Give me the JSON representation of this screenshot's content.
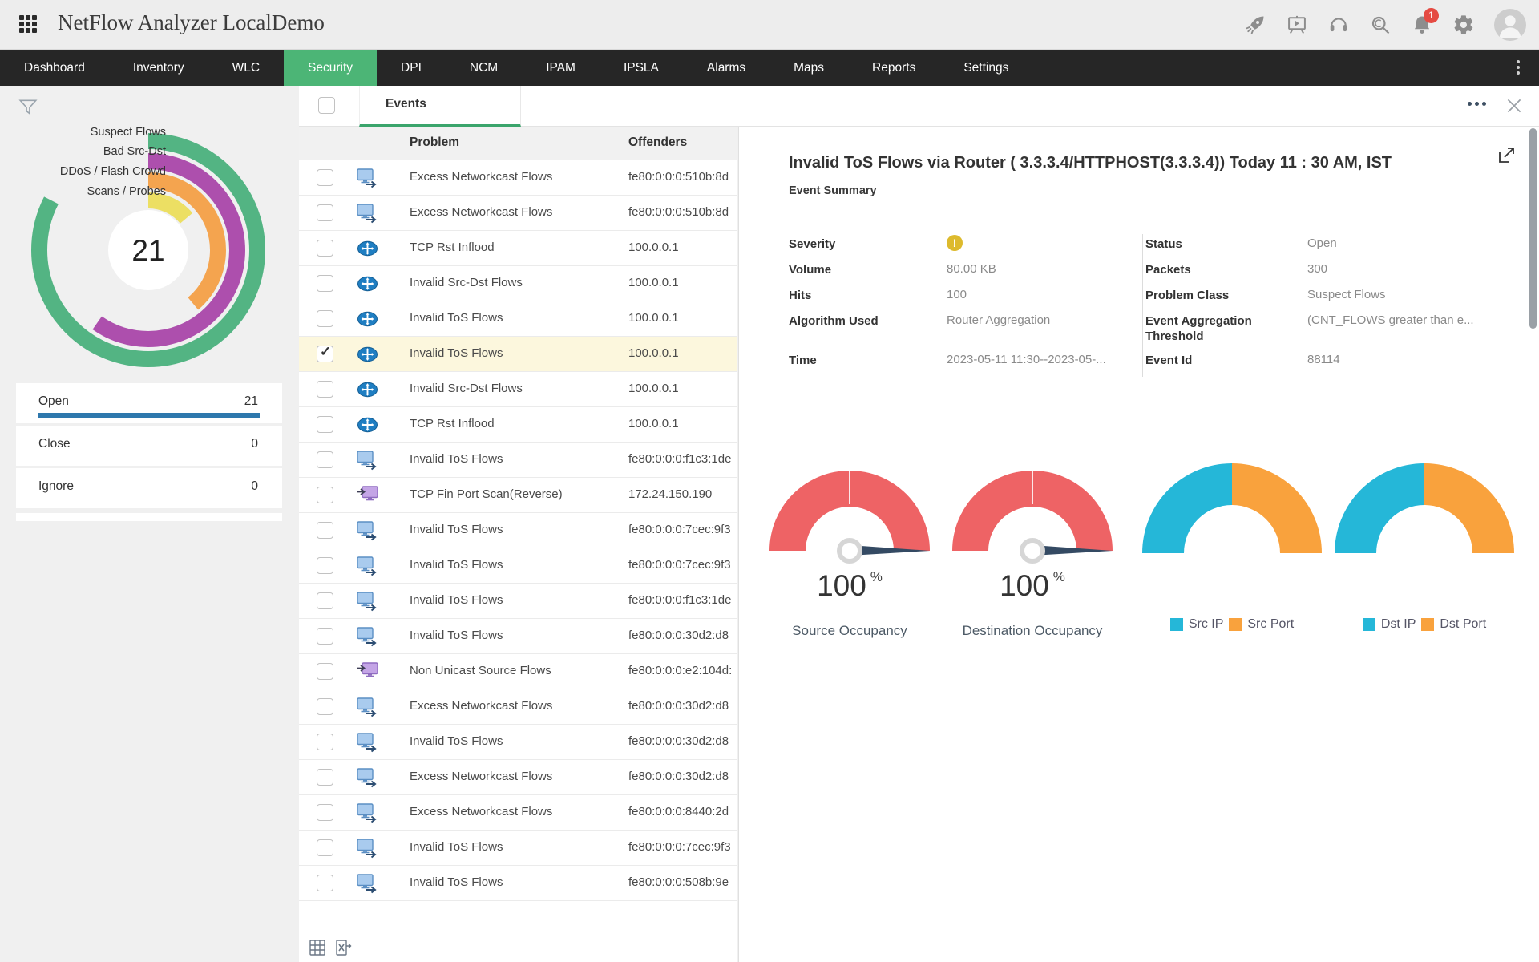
{
  "topbar": {
    "title": "NetFlow Analyzer LocalDemo",
    "notification_count": "1"
  },
  "nav": {
    "items": [
      {
        "label": "Dashboard",
        "state": ""
      },
      {
        "label": "Inventory",
        "state": ""
      },
      {
        "label": "WLC",
        "state": ""
      },
      {
        "label": "Security",
        "state": "active"
      },
      {
        "label": "DPI",
        "state": ""
      },
      {
        "label": "NCM",
        "state": ""
      },
      {
        "label": "IPAM",
        "state": ""
      },
      {
        "label": "IPSLA",
        "state": ""
      },
      {
        "label": "Alarms",
        "state": ""
      },
      {
        "label": "Maps",
        "state": ""
      },
      {
        "label": "Reports",
        "state": ""
      },
      {
        "label": "Settings",
        "state": ""
      }
    ],
    "active_color": "#4cb576"
  },
  "sidebar": {
    "chart": {
      "type": "radial-bar",
      "total": "21",
      "series": [
        {
          "label": "Suspect Flows",
          "color": "#53b483",
          "sweep_deg": 297
        },
        {
          "label": "Bad Src-Dst",
          "color": "#ad4fad",
          "sweep_deg": 215
        },
        {
          "label": "DDoS / Flash Crowd",
          "color": "#f4a44f",
          "sweep_deg": 140
        },
        {
          "label": "Scans / Probes",
          "color": "#ecdf63",
          "sweep_deg": 50
        }
      ]
    },
    "status": [
      {
        "label": "Open",
        "value": "21",
        "bar": "1",
        "bar_color": "#2e78ad"
      },
      {
        "label": "Close",
        "value": "0",
        "bar": "0",
        "bar_color": ""
      },
      {
        "label": "Ignore",
        "value": "0",
        "bar": "0",
        "bar_color": ""
      }
    ]
  },
  "events": {
    "tab_label": "Events",
    "columns": {
      "problem": "Problem",
      "offenders": "Offenders"
    },
    "rows": [
      {
        "icon": "host",
        "problem": "Excess Networkcast Flows",
        "offender": "fe80:0:0:0:510b:8d",
        "state": "",
        "checked": ""
      },
      {
        "icon": "host",
        "problem": "Excess Networkcast Flows",
        "offender": "fe80:0:0:0:510b:8d",
        "state": "",
        "checked": ""
      },
      {
        "icon": "router",
        "problem": "TCP Rst Inflood",
        "offender": "100.0.0.1",
        "state": "",
        "checked": ""
      },
      {
        "icon": "router",
        "problem": "Invalid Src-Dst Flows",
        "offender": "100.0.0.1",
        "state": "",
        "checked": ""
      },
      {
        "icon": "router",
        "problem": "Invalid ToS Flows",
        "offender": "100.0.0.1",
        "state": "",
        "checked": ""
      },
      {
        "icon": "router",
        "problem": "Invalid ToS Flows",
        "offender": "100.0.0.1",
        "state": "selected",
        "checked": "checked"
      },
      {
        "icon": "router",
        "problem": "Invalid Src-Dst Flows",
        "offender": "100.0.0.1",
        "state": "",
        "checked": ""
      },
      {
        "icon": "router",
        "problem": "TCP Rst Inflood",
        "offender": "100.0.0.1",
        "state": "",
        "checked": ""
      },
      {
        "icon": "host",
        "problem": "Invalid ToS Flows",
        "offender": "fe80:0:0:0:f1c3:1de",
        "state": "",
        "checked": ""
      },
      {
        "icon": "reverse",
        "problem": "TCP Fin Port Scan(Reverse)",
        "offender": "172.24.150.190",
        "state": "",
        "checked": ""
      },
      {
        "icon": "host",
        "problem": "Invalid ToS Flows",
        "offender": "fe80:0:0:0:7cec:9f3",
        "state": "",
        "checked": ""
      },
      {
        "icon": "host",
        "problem": "Invalid ToS Flows",
        "offender": "fe80:0:0:0:7cec:9f3",
        "state": "",
        "checked": ""
      },
      {
        "icon": "host",
        "problem": "Invalid ToS Flows",
        "offender": "fe80:0:0:0:f1c3:1de",
        "state": "",
        "checked": ""
      },
      {
        "icon": "host",
        "problem": "Invalid ToS Flows",
        "offender": "fe80:0:0:0:30d2:d8",
        "state": "",
        "checked": ""
      },
      {
        "icon": "reverse",
        "problem": "Non Unicast Source Flows",
        "offender": "fe80:0:0:0:e2:104d:",
        "state": "",
        "checked": ""
      },
      {
        "icon": "host",
        "problem": "Excess Networkcast Flows",
        "offender": "fe80:0:0:0:30d2:d8",
        "state": "",
        "checked": ""
      },
      {
        "icon": "host",
        "problem": "Invalid ToS Flows",
        "offender": "fe80:0:0:0:30d2:d8",
        "state": "",
        "checked": ""
      },
      {
        "icon": "host",
        "problem": "Excess Networkcast Flows",
        "offender": "fe80:0:0:0:30d2:d8",
        "state": "",
        "checked": ""
      },
      {
        "icon": "host",
        "problem": "Excess Networkcast Flows",
        "offender": "fe80:0:0:0:8440:2d",
        "state": "",
        "checked": ""
      },
      {
        "icon": "host",
        "problem": "Invalid ToS Flows",
        "offender": "fe80:0:0:0:7cec:9f3",
        "state": "",
        "checked": ""
      },
      {
        "icon": "host",
        "problem": "Invalid ToS Flows",
        "offender": "fe80:0:0:0:508b:9e",
        "state": "",
        "checked": ""
      }
    ]
  },
  "detail": {
    "title": "Invalid ToS Flows via Router ( 3.3.3.4/HTTPHOST(3.3.3.4)) Today 11 : 30 AM, IST",
    "subtitle": "Event Summary",
    "severity_color": "#ddba2d",
    "fields_left": [
      {
        "label": "Severity",
        "value": ""
      },
      {
        "label": "Volume",
        "value": "80.00 KB"
      },
      {
        "label": "Hits",
        "value": "100"
      },
      {
        "label": "Algorithm Used",
        "value": "Router Aggregation"
      },
      {
        "label": "Time",
        "value": "2023-05-11 11:30--2023-05-..."
      }
    ],
    "fields_right": [
      {
        "label": "Status",
        "value": "Open"
      },
      {
        "label": "Packets",
        "value": "300"
      },
      {
        "label": "Problem Class",
        "value": "Suspect Flows"
      },
      {
        "label": "Event Aggregation Threshold",
        "value": "(CNT_FLOWS greater than e..."
      },
      {
        "label": "Event Id",
        "value": "88114"
      }
    ],
    "gauges": [
      {
        "value": "100",
        "unit": "%",
        "label": "Source Occupancy",
        "color": "#ee6365",
        "needle_color": "#344a63"
      },
      {
        "value": "100",
        "unit": "%",
        "label": "Destination Occupancy",
        "color": "#ee6365",
        "needle_color": "#344a63"
      }
    ],
    "donuts": [
      {
        "legend": [
          "Src IP",
          "Src Port"
        ],
        "colors": [
          "#25b7d8",
          "#f9a23d"
        ],
        "values": [
          50,
          50
        ]
      },
      {
        "legend": [
          "Dst IP",
          "Dst Port"
        ],
        "colors": [
          "#25b7d8",
          "#f9a23d"
        ],
        "values": [
          50,
          50
        ]
      }
    ]
  }
}
